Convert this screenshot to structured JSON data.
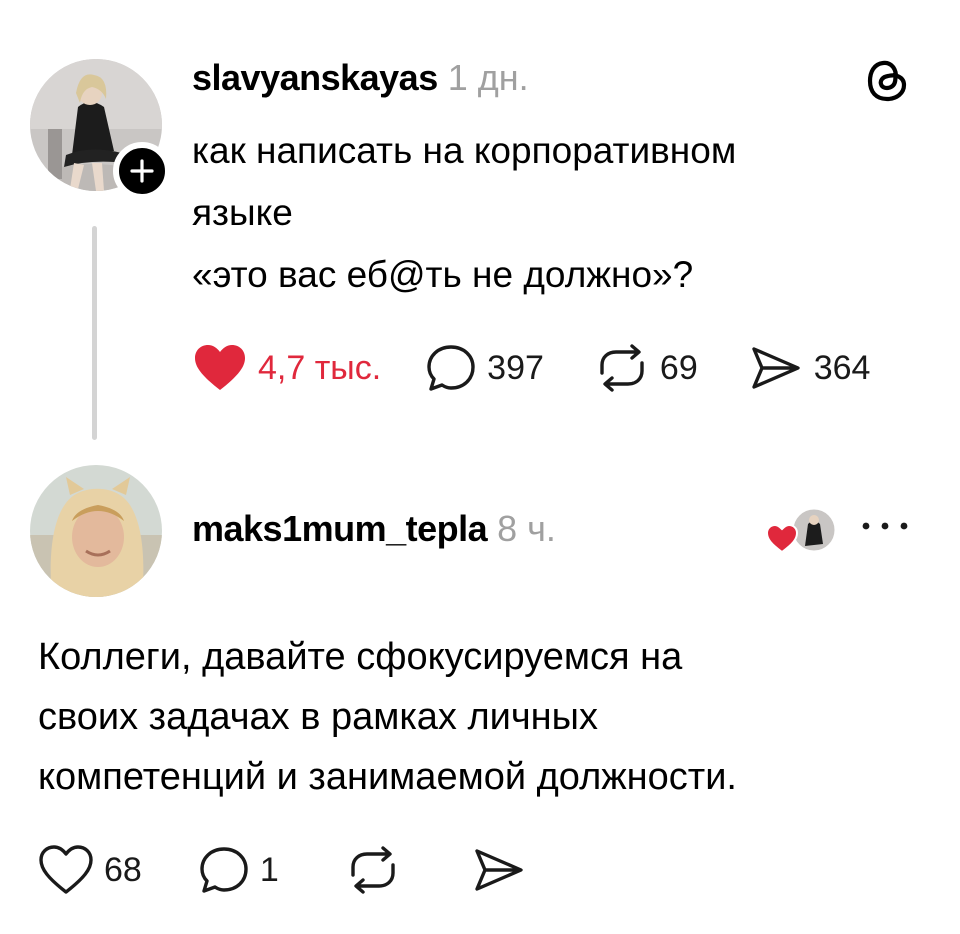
{
  "post1": {
    "username": "slavyanskayas",
    "time": "1 дн.",
    "text_line1": "как написать на корпоративном",
    "text_line2": "языке",
    "text_line3": "«это вас еб@ть не должно»?",
    "likes": "4,7 тыс.",
    "comments": "397",
    "reposts": "69",
    "shares": "364",
    "liked": true
  },
  "post2": {
    "username": "maks1mum_tepla",
    "time": "8 ч.",
    "text_line1": "Коллеги, давайте сфокусируемся на",
    "text_line2": "своих задачах в рамках личных",
    "text_line3": "компетенций и занимаемой должности.",
    "likes": "68",
    "comments": "1",
    "liked_by_author": true
  },
  "icons": {
    "logo": "threads-icon",
    "like": "heart-icon",
    "comment": "comment-bubble-icon",
    "repost": "repost-icon",
    "share": "send-icon",
    "more": "more-dots-icon",
    "follow": "plus-icon"
  },
  "colors": {
    "like_red": "#e0283c",
    "muted": "#a0a0a0",
    "thread_line": "#d4d4d4"
  }
}
